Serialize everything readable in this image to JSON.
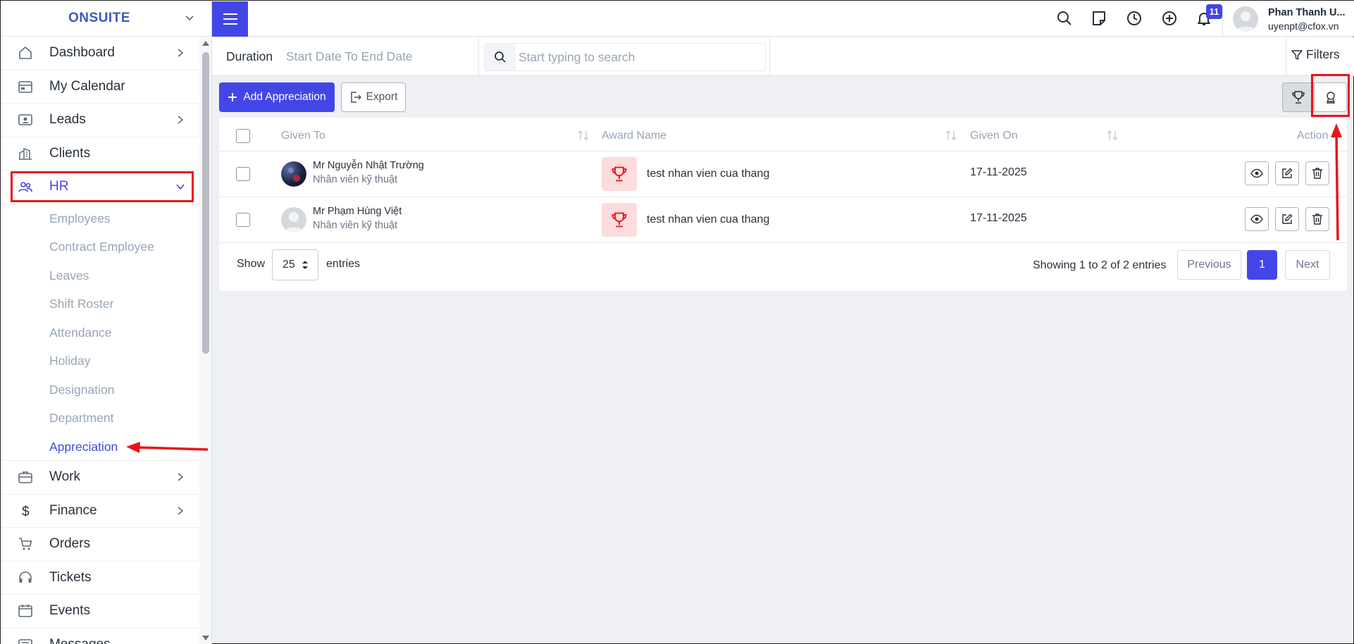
{
  "brand": {
    "name": "ONSUITE"
  },
  "sidebar": {
    "items": [
      {
        "label": "Dashboard",
        "icon": "home-icon",
        "chevron": true
      },
      {
        "label": "My Calendar",
        "icon": "calendar-icon",
        "chevron": false
      },
      {
        "label": "Leads",
        "icon": "contact-card-icon",
        "chevron": true
      },
      {
        "label": "Clients",
        "icon": "building-icon",
        "chevron": false
      },
      {
        "label": "HR",
        "icon": "people-icon",
        "chevron": true,
        "expanded": true
      }
    ],
    "hr_submenu": [
      {
        "label": "Employees"
      },
      {
        "label": "Contract Employee"
      },
      {
        "label": "Leaves"
      },
      {
        "label": "Shift Roster"
      },
      {
        "label": "Attendance"
      },
      {
        "label": "Holiday"
      },
      {
        "label": "Designation"
      },
      {
        "label": "Department"
      },
      {
        "label": "Appreciation",
        "active": true
      }
    ],
    "items_after": [
      {
        "label": "Work",
        "icon": "briefcase-icon",
        "chevron": true
      },
      {
        "label": "Finance",
        "icon": "dollar-icon",
        "chevron": true
      },
      {
        "label": "Orders",
        "icon": "cart-icon",
        "chevron": false
      },
      {
        "label": "Tickets",
        "icon": "headset-icon",
        "chevron": false
      },
      {
        "label": "Events",
        "icon": "event-calendar-icon",
        "chevron": false
      },
      {
        "label": "Messages",
        "icon": "message-icon",
        "chevron": false
      }
    ]
  },
  "topbar": {
    "notification_count": "11",
    "user_name": "Phan Thanh U...",
    "user_email": "uyenpt@cfox.vn"
  },
  "filterbar": {
    "duration_label": "Duration",
    "date_range": "Start Date To End Date",
    "search_placeholder": "Start typing to search",
    "filters_label": "Filters"
  },
  "actions": {
    "add_label": "Add Appreciation",
    "export_label": "Export"
  },
  "table": {
    "columns": {
      "given_to": "Given To",
      "award_name": "Award Name",
      "given_on": "Given On",
      "action": "Action"
    },
    "rows": [
      {
        "name": "Mr Nguyễn Nhật Trường",
        "title": "Nhân viên kỹ thuật",
        "award": "test nhan vien cua thang",
        "date": "17-11-2025",
        "avatar": "photo"
      },
      {
        "name": "Mr Phạm Hùng Việt",
        "title": "Nhân viên kỹ thuật",
        "award": "test nhan vien cua thang",
        "date": "17-11-2025",
        "avatar": "default"
      }
    ]
  },
  "pagination": {
    "show_label": "Show",
    "page_size": "25",
    "entries_label": "entries",
    "summary": "Showing 1 to 2 of 2 entries",
    "previous": "Previous",
    "current_page": "1",
    "next": "Next"
  },
  "colors": {
    "accent": "#4346e6",
    "annotation_red": "#e8141d",
    "award_bg": "#fcdcdd",
    "award_icon": "#e8141d"
  }
}
